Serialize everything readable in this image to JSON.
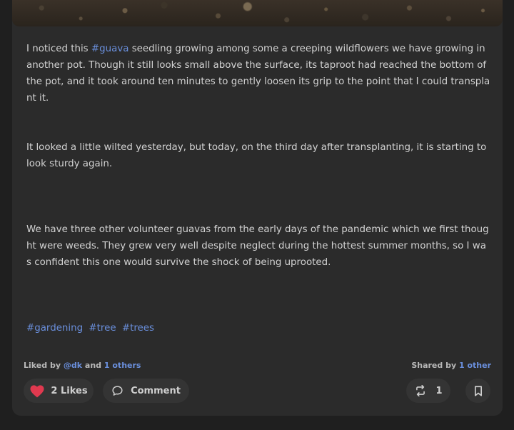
{
  "post": {
    "p1_pre": "I noticed this ",
    "p1_tag": "#guava",
    "p1_post": " seedling growing among some a creeping wildflowers we have growing in another pot. Though it still looks small above the surface, its taproot had reached the bottom of the pot, and it took around ten minutes to gently loosen its grip to the point that I could transplant it.",
    "p2": "It looked a little wilted yesterday, but today, on the third day after transplanting, it is starting to look sturdy again.",
    "p3": "We have three other volunteer guavas from the early days of the pandemic which we first thought were weeds. They grew very well despite neglect during the hottest summer months, so I was confident this one would survive the shock of being uprooted.",
    "tags": [
      "#gardening",
      "#tree",
      "#trees"
    ]
  },
  "meta": {
    "liked_by_prefix": "Liked by",
    "liked_by_user": "@dk",
    "liked_by_and": "and",
    "liked_by_others": "1 others",
    "shared_by_prefix": "Shared by",
    "shared_by_others": "1 other"
  },
  "actions": {
    "likes_count": "2",
    "likes_label": "Likes",
    "comment_label": "Comment",
    "share_count": "1"
  },
  "colors": {
    "heart": "#e0394f",
    "link": "#6a8fdc"
  }
}
